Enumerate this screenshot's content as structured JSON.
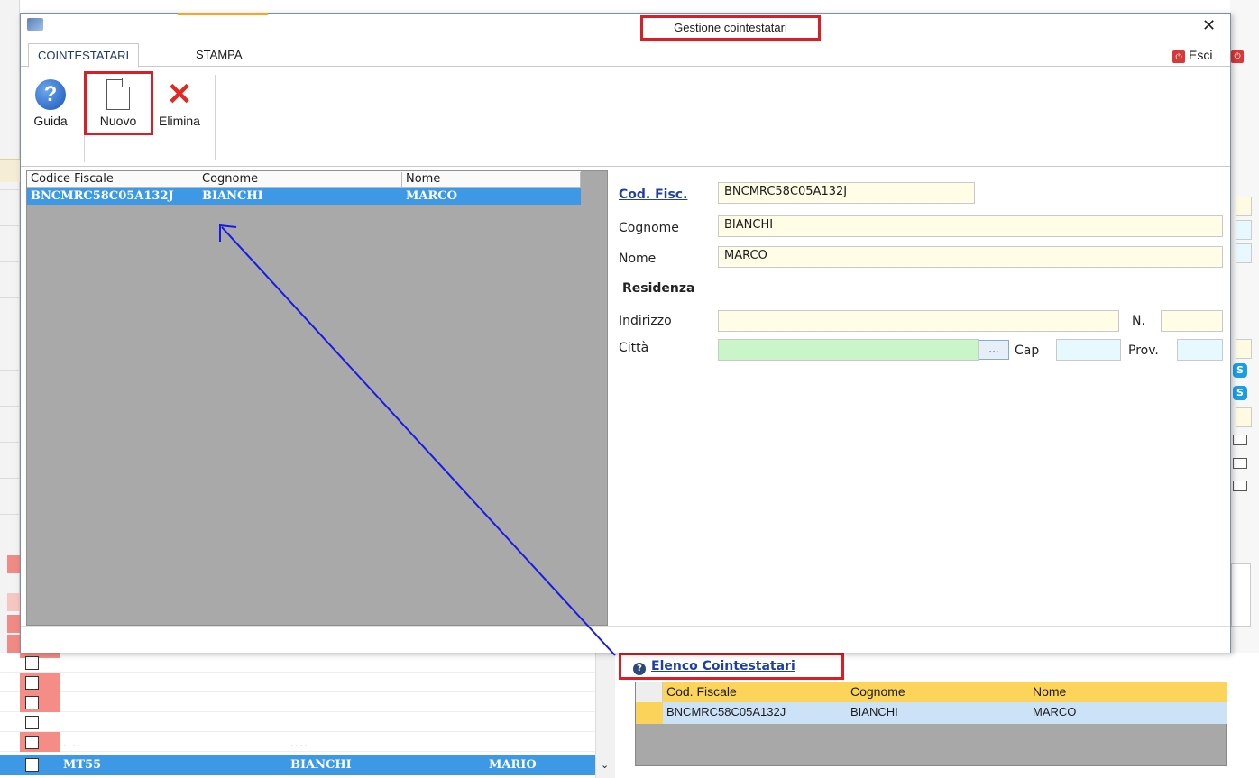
{
  "dialog": {
    "title": "Gestione cointestatari",
    "tabs": [
      "COINTESTATARI",
      "STAMPA"
    ],
    "esci_label": "Esci",
    "ribbon": {
      "guida": "Guida",
      "nuovo": "Nuovo",
      "elimina": "Elimina"
    },
    "list": {
      "columns": [
        "Codice Fiscale",
        "Cognome",
        "Nome"
      ],
      "rows": [
        {
          "codice_fiscale": "BNCMRC58C05A132J",
          "cognome": "BIANCHI",
          "nome": "MARCO"
        }
      ]
    },
    "form": {
      "cod_fisc_label": "Cod. Fisc.",
      "cod_fisc_value": "BNCMRC58C05A132J",
      "cognome_label": "Cognome",
      "cognome_value": "BIANCHI",
      "nome_label": "Nome",
      "nome_value": "MARCO",
      "residenza_label": "Residenza",
      "indirizzo_label": "Indirizzo",
      "indirizzo_value": "",
      "numero_label": "N.",
      "numero_value": "",
      "citta_label": "Città",
      "citta_value": "",
      "dots_label": "...",
      "cap_label": "Cap",
      "cap_value": "",
      "prov_label": "Prov.",
      "prov_value": ""
    }
  },
  "background": {
    "elenco_title": "Elenco Cointestatari",
    "elenco_columns": [
      "Cod. Fiscale",
      "Cognome",
      "Nome"
    ],
    "elenco_rows": [
      {
        "codice_fiscale": "BNCMRC58C05A132J",
        "cognome": "BIANCHI",
        "nome": "MARCO"
      }
    ],
    "bottom_row": {
      "code": "MT55",
      "cognome": "BIANCHI",
      "nome": "MARIO"
    },
    "dots": "....",
    "right_edge_esci_icon": "esci-icon"
  },
  "colors": {
    "highlight_box": "#d81f26",
    "selected_row": "#3d99e6",
    "link": "#1f3fa6",
    "arrow": "#1a1ae6",
    "tab_accent": "#f6a626"
  },
  "icons": [
    "help-icon",
    "new-document-icon",
    "delete-icon",
    "close-icon",
    "esci-icon",
    "info-icon",
    "skype-icon",
    "mail-icon"
  ]
}
